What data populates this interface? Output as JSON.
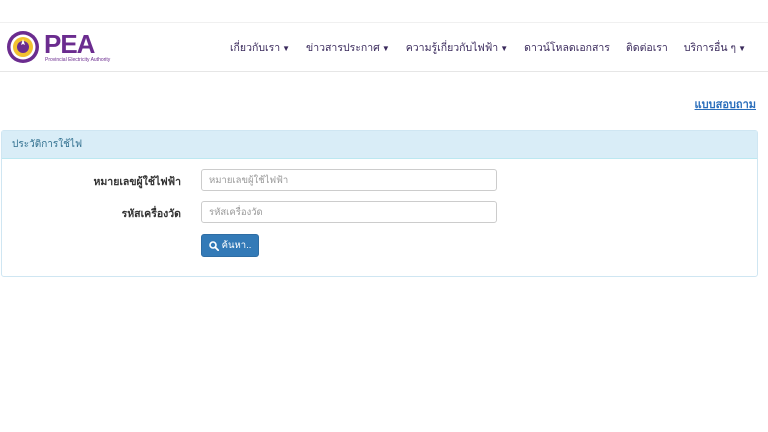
{
  "brand": {
    "name": "PEA",
    "subtitle": "Provincial Electricity Authority",
    "color": "#6b2c8f"
  },
  "nav": {
    "items": [
      {
        "label": "เกี่ยวกับเรา",
        "caret": "▼"
      },
      {
        "label": "ข่าวสารประกาศ",
        "caret": "▼"
      },
      {
        "label": "ความรู้เกี่ยวกับไฟฟ้า",
        "caret": "▼"
      },
      {
        "label": "ดาวน์โหลดเอกสาร",
        "caret": ""
      },
      {
        "label": "ติดต่อเรา",
        "caret": ""
      },
      {
        "label": "บริการอื่น ๆ",
        "caret": "▼"
      }
    ]
  },
  "survey_link": "แบบสอบถาม",
  "panel": {
    "title": "ประวัติการใช้ไฟ",
    "fields": {
      "customer_no": {
        "label": "หมายเลขผู้ใช้ไฟฟ้า",
        "placeholder": "หมายเลขผู้ใช้ไฟฟ้า",
        "value": ""
      },
      "meter_code": {
        "label": "รหัสเครื่องวัด",
        "placeholder": "รหัสเครื่องวัด",
        "value": ""
      }
    },
    "search_button": "ค้นหา.."
  },
  "colors": {
    "panel_header_bg": "#d9edf7",
    "button_bg": "#337ab7",
    "link": "#2a6ebb"
  }
}
